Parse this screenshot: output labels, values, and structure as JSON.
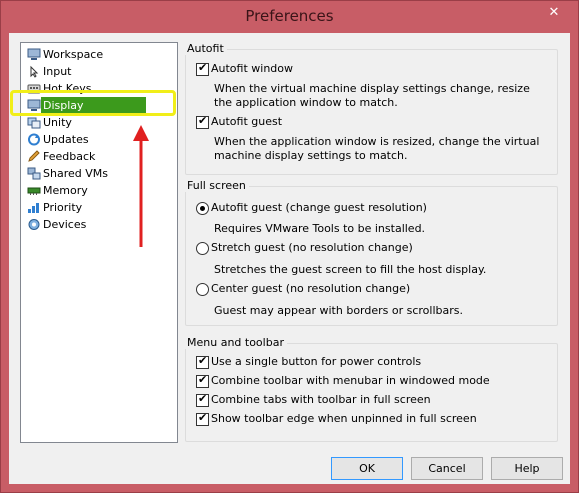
{
  "window": {
    "title": "Preferences",
    "close_glyph": "✕"
  },
  "nav": {
    "items": [
      {
        "label": "Workspace",
        "icon": "workspace-icon"
      },
      {
        "label": "Input",
        "icon": "input-icon"
      },
      {
        "label": "Hot Keys",
        "icon": "hotkeys-icon"
      },
      {
        "label": "Display",
        "icon": "display-icon",
        "selected": true
      },
      {
        "label": "Unity",
        "icon": "unity-icon"
      },
      {
        "label": "Updates",
        "icon": "updates-icon"
      },
      {
        "label": "Feedback",
        "icon": "feedback-icon"
      },
      {
        "label": "Shared VMs",
        "icon": "shared-vms-icon"
      },
      {
        "label": "Memory",
        "icon": "memory-icon"
      },
      {
        "label": "Priority",
        "icon": "priority-icon"
      },
      {
        "label": "Devices",
        "icon": "devices-icon"
      }
    ]
  },
  "autofit": {
    "title": "Autofit",
    "window_label": "Autofit window",
    "window_checked": true,
    "window_desc": "When the virtual machine display settings change, resize the application window to match.",
    "guest_label": "Autofit guest",
    "guest_checked": true,
    "guest_desc": "When the application window is resized, change the virtual machine display settings to match."
  },
  "fullscreen": {
    "title": "Full screen",
    "options": [
      {
        "label": "Autofit guest (change guest resolution)",
        "desc": "Requires VMware Tools to be installed.",
        "selected": true
      },
      {
        "label": "Stretch guest (no resolution change)",
        "desc": "Stretches the guest screen to fill the host display.",
        "selected": false
      },
      {
        "label": "Center guest (no resolution change)",
        "desc": "Guest may appear with borders or scrollbars.",
        "selected": false
      }
    ]
  },
  "menu_toolbar": {
    "title": "Menu and toolbar",
    "options": [
      {
        "label": "Use a single button for power controls",
        "checked": true
      },
      {
        "label": "Combine toolbar with menubar in windowed mode",
        "checked": true
      },
      {
        "label": "Combine tabs with toolbar in full screen",
        "checked": true
      },
      {
        "label": "Show toolbar edge when unpinned in full screen",
        "checked": true
      }
    ]
  },
  "buttons": {
    "ok": "OK",
    "cancel": "Cancel",
    "help": "Help"
  },
  "check_glyph": "✔",
  "colors": {
    "selection": "#3c9a1c",
    "highlight": "#f1ee18",
    "arrow": "#e02020",
    "frame": "#c85d66"
  }
}
